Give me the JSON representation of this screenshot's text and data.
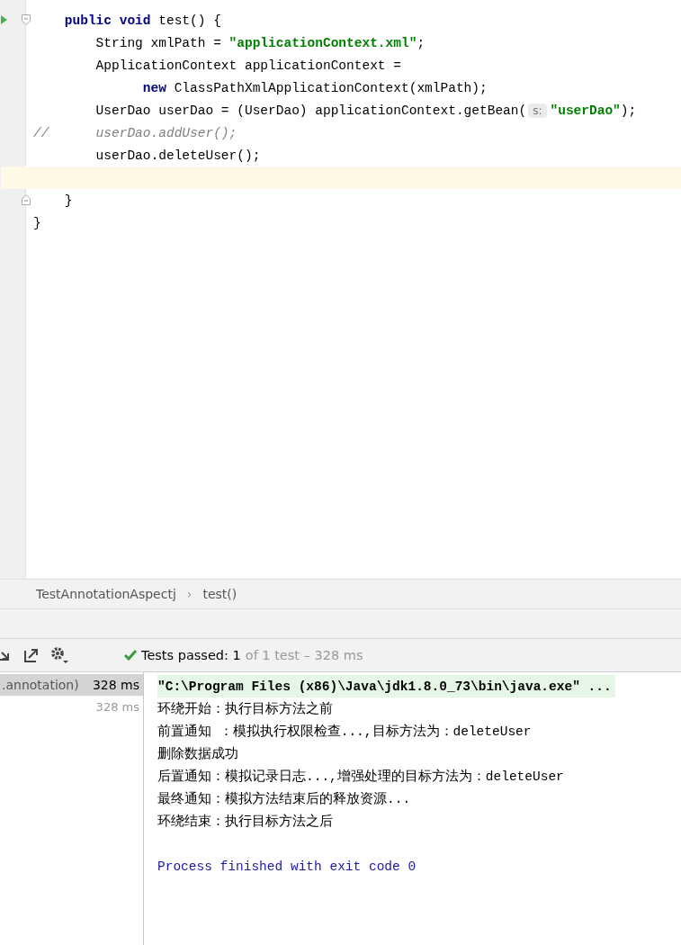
{
  "editor": {
    "lines": [
      {
        "kind": "run-fold",
        "highlighted": false,
        "tokens": [
          {
            "kind": "keyword",
            "text": "    public void"
          },
          {
            "kind": "plain",
            "text": " test() {"
          }
        ]
      },
      {
        "kind": "code",
        "highlighted": false,
        "tokens": [
          {
            "kind": "plain",
            "text": "        String xmlPath = "
          },
          {
            "kind": "string",
            "text": "\"applicationContext.xml\""
          },
          {
            "kind": "plain",
            "text": ";"
          }
        ]
      },
      {
        "kind": "code",
        "highlighted": false,
        "tokens": [
          {
            "kind": "plain",
            "text": "        ApplicationContext applicationContext ="
          }
        ]
      },
      {
        "kind": "code",
        "highlighted": false,
        "tokens": [
          {
            "kind": "keyword",
            "text": "              new"
          },
          {
            "kind": "plain",
            "text": " ClassPathXmlApplicationContext(xmlPath);"
          }
        ]
      },
      {
        "kind": "code",
        "highlighted": false,
        "tokens": [
          {
            "kind": "plain",
            "text": "        UserDao userDao = (UserDao) applicationContext.getBean("
          },
          {
            "kind": "hint",
            "text": "s:"
          },
          {
            "kind": "string",
            "text": "\"userDao\""
          },
          {
            "kind": "plain",
            "text": ");"
          }
        ]
      },
      {
        "kind": "code",
        "highlighted": false,
        "tokens": [
          {
            "kind": "comment",
            "text": "//      userDao.addUser();"
          }
        ]
      },
      {
        "kind": "code",
        "highlighted": false,
        "tokens": [
          {
            "kind": "plain",
            "text": "        userDao.deleteUser();"
          }
        ]
      },
      {
        "kind": "code",
        "highlighted": true
      },
      {
        "kind": "fold-end",
        "highlighted": false,
        "tokens": [
          {
            "kind": "plain",
            "text": "    }"
          }
        ]
      },
      {
        "kind": "code",
        "highlighted": false,
        "tokens": [
          {
            "kind": "plain",
            "text": "}"
          }
        ]
      }
    ]
  },
  "breadcrumbs": {
    "items": [
      "TestAnnotationAspectj",
      "test()"
    ],
    "separator": "›"
  },
  "test_status": {
    "passed": "Tests passed: 1",
    "detail": "of 1 test – 328 ms"
  },
  "test_tree": [
    {
      "label": ".annotation)",
      "time": "328 ms",
      "selected": true
    },
    {
      "time": "328 ms",
      "selected": false
    }
  ],
  "console": [
    {
      "kind": "command",
      "text": "\"C:\\Program Files (x86)\\Java\\jdk1.8.0_73\\bin\\java.exe\" ..."
    },
    {
      "kind": "output",
      "text": "环绕开始：执行目标方法之前"
    },
    {
      "kind": "output",
      "text": "前置通知 ：模拟执行权限检查...,目标方法为：deleteUser"
    },
    {
      "kind": "output",
      "text": "删除数据成功"
    },
    {
      "kind": "output",
      "text": "后置通知：模拟记录日志...,增强处理的目标方法为：deleteUser"
    },
    {
      "kind": "output",
      "text": "最终通知：模拟方法结束后的释放资源..."
    },
    {
      "kind": "output",
      "text": "环绕结束：执行目标方法之后"
    },
    {
      "kind": "blank"
    },
    {
      "kind": "exit",
      "text": "Process finished with exit code 0"
    }
  ]
}
